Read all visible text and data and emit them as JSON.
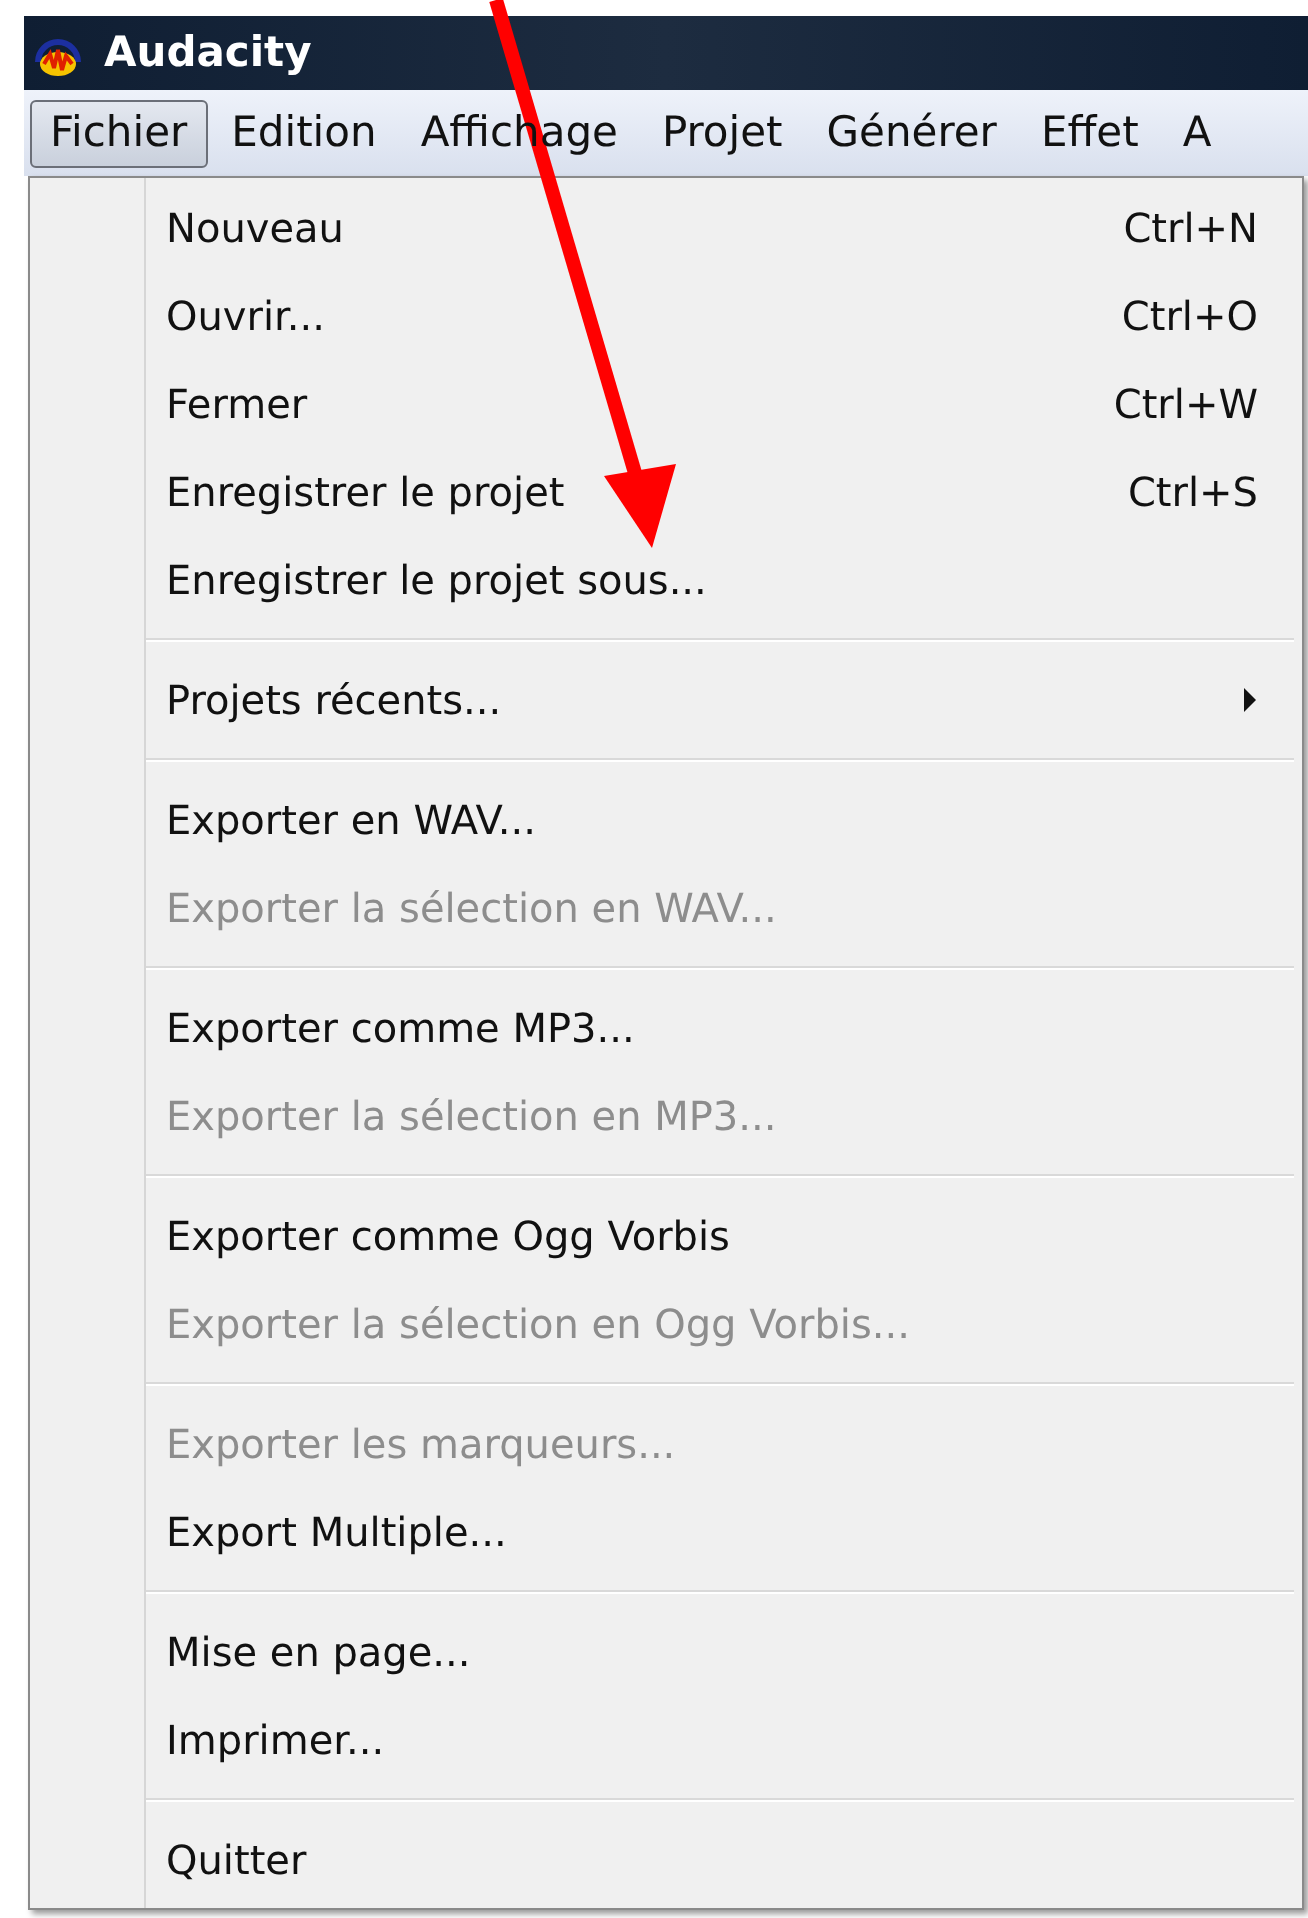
{
  "window": {
    "title": "Audacity"
  },
  "menubar": [
    {
      "label": "Fichier",
      "selected": true
    },
    {
      "label": "Edition",
      "selected": false
    },
    {
      "label": "Affichage",
      "selected": false
    },
    {
      "label": "Projet",
      "selected": false
    },
    {
      "label": "Générer",
      "selected": false
    },
    {
      "label": "Effet",
      "selected": false
    },
    {
      "label": "A",
      "selected": false
    }
  ],
  "menu": {
    "sections": [
      {
        "items": [
          {
            "label": "Nouveau",
            "shortcut": "Ctrl+N",
            "disabled": false,
            "submenu": false
          },
          {
            "label": "Ouvrir...",
            "shortcut": "Ctrl+O",
            "disabled": false,
            "submenu": false
          },
          {
            "label": "Fermer",
            "shortcut": "Ctrl+W",
            "disabled": false,
            "submenu": false
          },
          {
            "label": "Enregistrer le projet",
            "shortcut": "Ctrl+S",
            "disabled": false,
            "submenu": false
          },
          {
            "label": "Enregistrer le projet sous...",
            "disabled": false,
            "submenu": false
          }
        ]
      },
      {
        "items": [
          {
            "label": "Projets récents...",
            "disabled": false,
            "submenu": true
          }
        ]
      },
      {
        "items": [
          {
            "label": "Exporter en WAV...",
            "disabled": false,
            "submenu": false
          },
          {
            "label": "Exporter la sélection en WAV...",
            "disabled": true,
            "submenu": false
          }
        ]
      },
      {
        "items": [
          {
            "label": "Exporter comme MP3...",
            "disabled": false,
            "submenu": false
          },
          {
            "label": "Exporter la sélection en MP3...",
            "disabled": true,
            "submenu": false
          }
        ]
      },
      {
        "items": [
          {
            "label": "Exporter comme Ogg Vorbis",
            "disabled": false,
            "submenu": false
          },
          {
            "label": "Exporter la sélection en Ogg Vorbis...",
            "disabled": true,
            "submenu": false
          }
        ]
      },
      {
        "items": [
          {
            "label": "Exporter les marqueurs...",
            "disabled": true,
            "submenu": false
          },
          {
            "label": "Export Multiple...",
            "disabled": false,
            "submenu": false
          }
        ]
      },
      {
        "items": [
          {
            "label": "Mise en page...",
            "disabled": false,
            "submenu": false
          },
          {
            "label": "Imprimer...",
            "disabled": false,
            "submenu": false
          }
        ]
      },
      {
        "items": [
          {
            "label": "Quitter",
            "disabled": false,
            "submenu": false
          }
        ]
      }
    ]
  }
}
